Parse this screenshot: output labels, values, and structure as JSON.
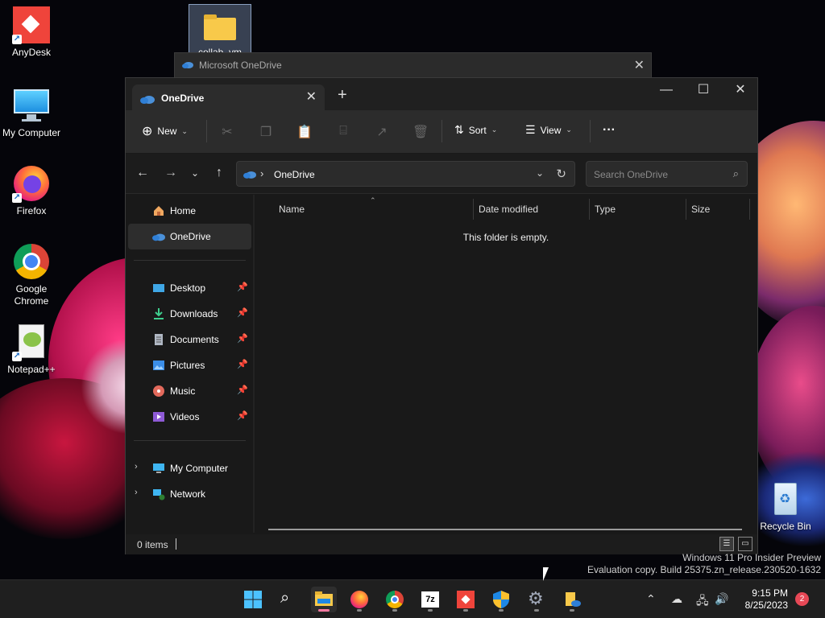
{
  "desktop": {
    "icons": [
      {
        "label": "AnyDesk"
      },
      {
        "label": "My Computer"
      },
      {
        "label": "Firefox"
      },
      {
        "label": "Google Chrome"
      },
      {
        "label": "Notepad++"
      },
      {
        "label": "Recycle Bin"
      },
      {
        "label": "collab_vm"
      }
    ]
  },
  "onedrive_window": {
    "title": "Microsoft OneDrive"
  },
  "explorer": {
    "tab_title": "OneDrive",
    "toolbar": {
      "new_label": "New",
      "sort_label": "Sort",
      "view_label": "View",
      "more_label": "···"
    },
    "address": {
      "crumb": "OneDrive"
    },
    "search_placeholder": "Search OneDrive",
    "nav": {
      "home": "Home",
      "onedrive": "OneDrive",
      "desktop": "Desktop",
      "downloads": "Downloads",
      "documents": "Documents",
      "pictures": "Pictures",
      "music": "Music",
      "videos": "Videos",
      "my_computer": "My Computer",
      "network": "Network"
    },
    "columns": {
      "name": "Name",
      "date": "Date modified",
      "type": "Type",
      "size": "Size"
    },
    "empty_text": "This folder is empty.",
    "status": {
      "items": "0 items"
    }
  },
  "watermark": {
    "line1": "Windows 11 Pro Insider Preview",
    "line2": "Evaluation copy. Build 25375.zn_release.230520-1632"
  },
  "taskbar": {
    "clock_time": "9:15 PM",
    "clock_date": "8/25/2023",
    "notification_count": "2"
  },
  "colors": {
    "accent": "#4cc2ff",
    "onedrive": "#2f7fd6",
    "notif_badge": "#e74856"
  }
}
